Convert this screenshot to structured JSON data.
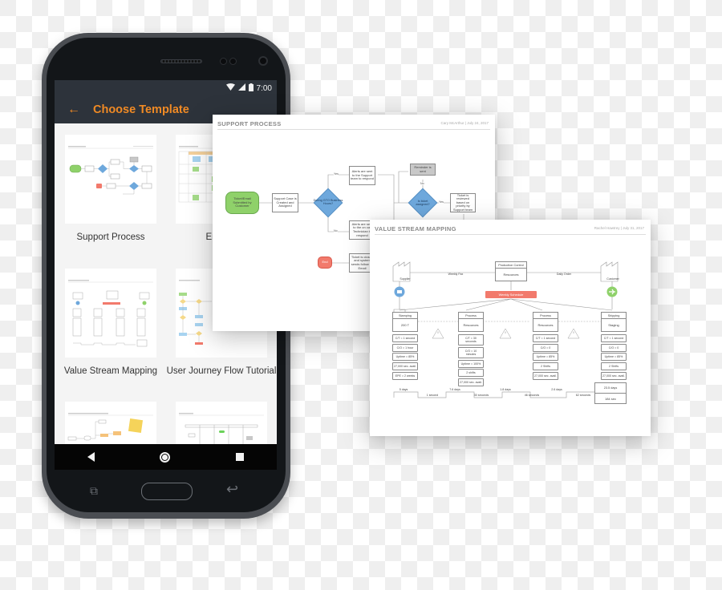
{
  "status_bar": {
    "time": "7:00",
    "icons": [
      "wifi-icon",
      "signal-icon",
      "battery-icon"
    ]
  },
  "app_bar": {
    "back_icon": "arrow-left-icon",
    "back_glyph": "←",
    "title": "Choose Template"
  },
  "templates": [
    {
      "label": "Support Process"
    },
    {
      "label": "Email F"
    },
    {
      "label": "Value Stream Mapping"
    },
    {
      "label": "User Journey Flow Tutorial"
    },
    {
      "label": ""
    },
    {
      "label": ""
    }
  ],
  "nav_bar": {
    "back": "nav-back-icon",
    "home": "nav-home-icon",
    "recent": "nav-recent-icon"
  },
  "hardware": {
    "recent_glyph": "⧉",
    "back_glyph": "↩"
  },
  "support_doc": {
    "title": "SUPPORT PROCESS",
    "meta": "Cary McArthur  |  July 24, 2017",
    "nodes": {
      "start": "Ticket/Email Submitted by Customer",
      "case": "Support Case is Created and Assigned",
      "hours": "During GTO Business Hours?",
      "alert_team": "Alerts are sent to the Support team to respond",
      "alert_tech": "Alerts are sent to the on call Technician to respond",
      "reminder": "Reminder is sent",
      "assigned": "Is ticket assigned?",
      "reviewed": "Ticket is reviewed based on priority by Support team",
      "closed": "Ticket is closed and system sends follow up Email",
      "end": "End"
    },
    "labels": {
      "yes": "Yes",
      "no": "No"
    }
  },
  "vsm_doc": {
    "title": "VALUE STREAM MAPPING",
    "meta": "Rachel Hawtrey  |  July 31, 2017",
    "supplier": "Supplier",
    "customer": "Customer",
    "production_control": "Production Control",
    "resources": "Resources",
    "weekly_fax": "Weekly Fax",
    "daily_order": "Daily Order",
    "schedule": "Weekly Schedule",
    "processes": [
      {
        "head": "Stamping",
        "body": "200 T",
        "metrics": [
          "C/T = 1 second",
          "C/O = 1 hour",
          "Uptime = 85%",
          "27,000 sec. avail.",
          "EPE = 2 weeks"
        ]
      },
      {
        "head": "Process",
        "body": "Resources",
        "metrics": [
          "C/T = 30 seconds",
          "C/O = 10 minutes",
          "Uptime = 100%",
          "2 shifts",
          "27,000 sec. avail."
        ]
      },
      {
        "head": "Process",
        "body": "Resources",
        "metrics": [
          "C/T = 1 second",
          "C/O = 0",
          "Uptime = 85%",
          "2 Shifts",
          "27,000 sec. avail."
        ]
      },
      {
        "head": "Shipping",
        "body": "Staging",
        "metrics": [
          "C/T = 1 second",
          "C/O = 0",
          "Uptime = 85%",
          "2 Shifts",
          "27,000 sec. avail."
        ]
      }
    ],
    "inventory_label": "I",
    "timeline": {
      "days": [
        "5 days",
        "7.6 days",
        "1.8 days",
        "2.6 days"
      ],
      "seconds": [
        "1 second",
        "30 seconds",
        "46 seconds",
        "62 seconds"
      ],
      "total_days": "23.5 days",
      "total_sec": "184 sec"
    }
  }
}
